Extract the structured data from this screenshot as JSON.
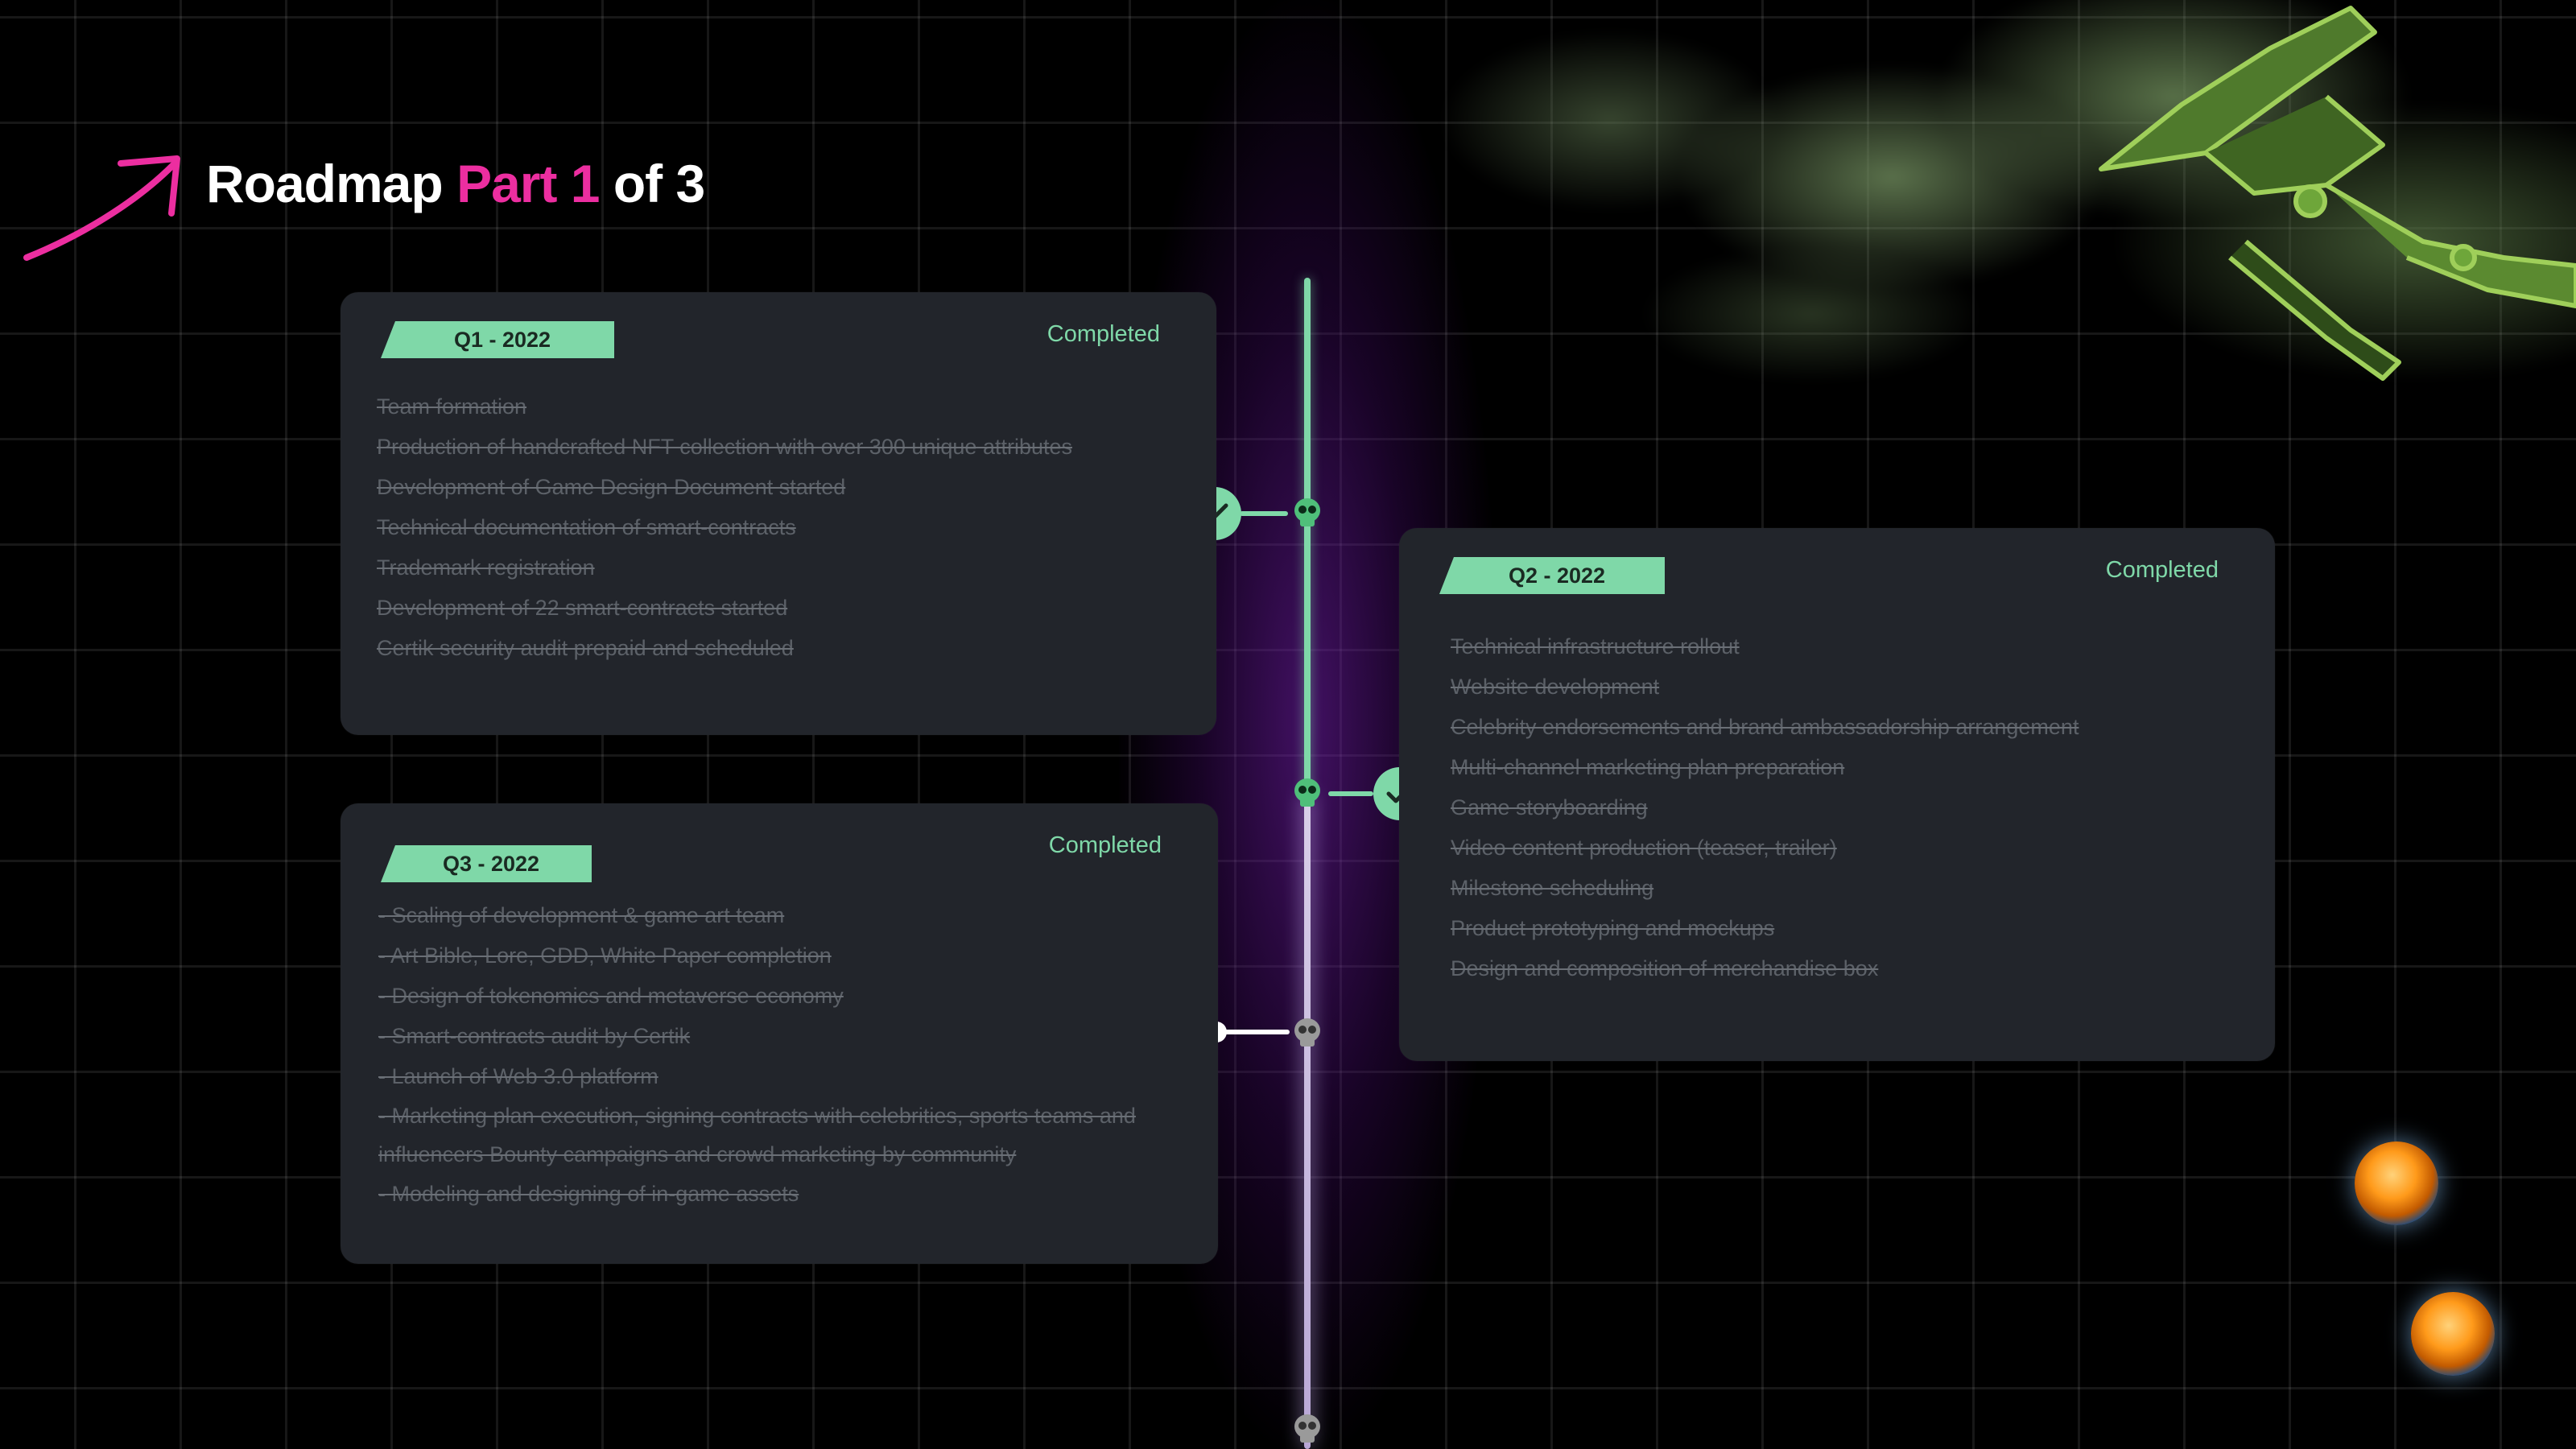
{
  "header": {
    "title_start": "Roadmap",
    "title_accent": "Part 1",
    "title_end": "of 3"
  },
  "colors": {
    "accent_pink": "#ec2ea0",
    "accent_green": "#7fd8a8",
    "card_bg": "#22252b"
  },
  "cards": [
    {
      "quarter": "Q1 - 2022",
      "status": "Completed",
      "items": [
        "Team formation",
        "Production of handcrafted NFT collection with over 300 unique attributes",
        "Development of Game Design Document started",
        "Technical documentation of smart-contracts",
        "Trademark registration",
        "Development of 22 smart-contracts started",
        "Certik security audit prepaid and scheduled"
      ]
    },
    {
      "quarter": "Q2 - 2022",
      "status": "Completed",
      "items": [
        "Technical infrastructure rollout",
        "Website development",
        "Celebrity endorsements and brand ambassadorship arrangement",
        "Multi-channel marketing plan preparation",
        "Game storyboarding",
        "Video content production (teaser, trailer)",
        "Milestone scheduling",
        "Product prototyping and mockups",
        "Design and composition of merchandise box"
      ]
    },
    {
      "quarter": "Q3 - 2022",
      "status": "Completed",
      "items": [
        "- Scaling of development & game art team",
        "- Art Bible, Lore, GDD, White Paper completion",
        "- Design of tokenomics and metaverse economy",
        "- Smart-contracts audit by Certik",
        "- Launch of Web 3.0 platform",
        "- Marketing plan execution, signing contracts with celebrities, sports teams and influencers Bounty campaigns and crowd marketing by community",
        "- Modeling and designing of in-game assets"
      ]
    }
  ],
  "icons": {
    "arrow": "arrow-icon",
    "check": "check-icon",
    "skull": "skull-icon",
    "orb": "orb-icon",
    "drone": "drone-illustration"
  }
}
